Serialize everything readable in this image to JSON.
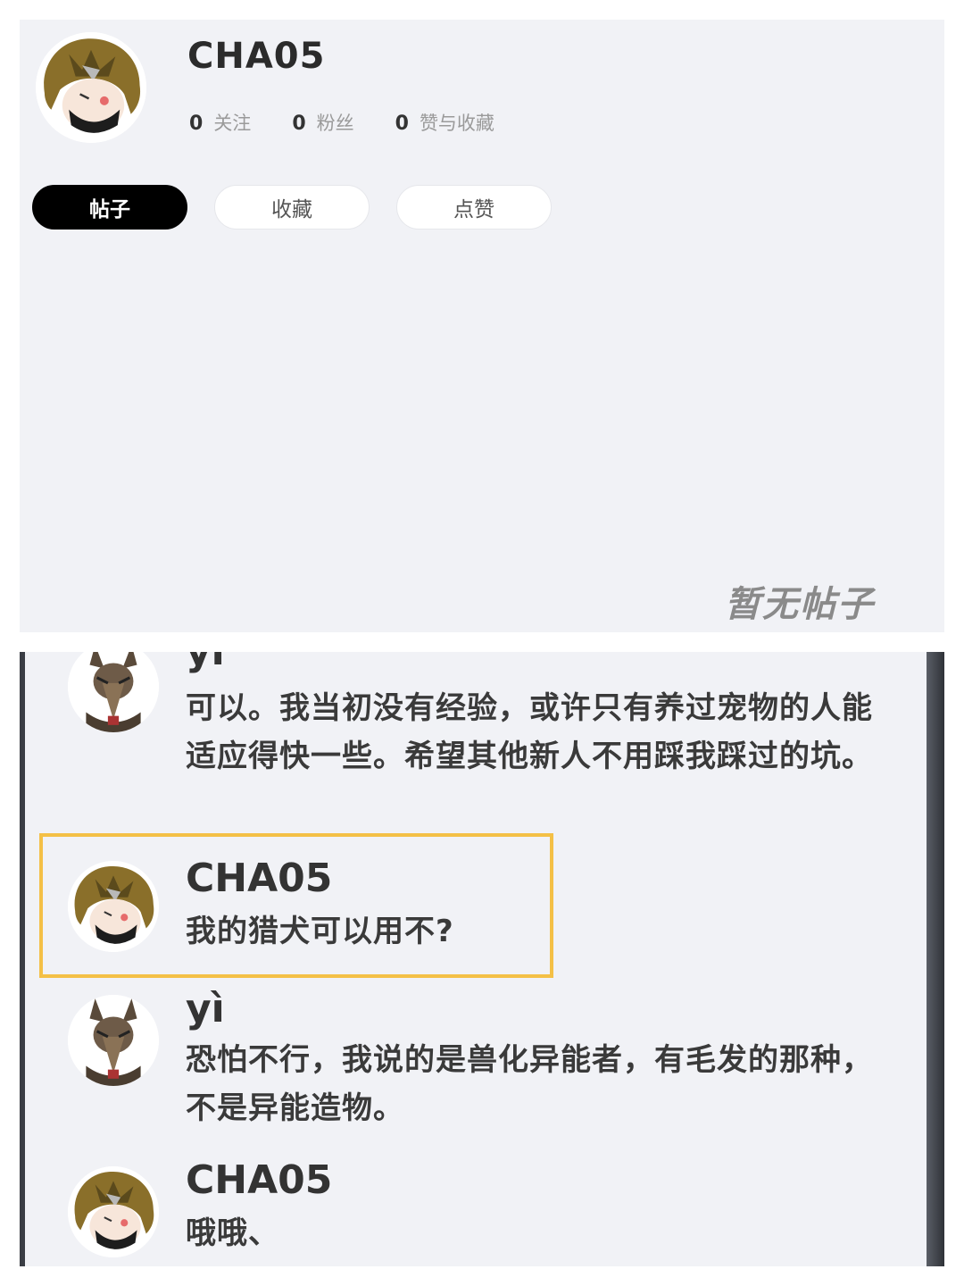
{
  "profile": {
    "username": "CHA05",
    "stats": [
      {
        "num": "0",
        "label": "关注"
      },
      {
        "num": "0",
        "label": "粉丝"
      },
      {
        "num": "0",
        "label": "赞与收藏"
      }
    ],
    "tabs": [
      {
        "label": "帖子",
        "active": true
      },
      {
        "label": "收藏",
        "active": false
      },
      {
        "label": "点赞",
        "active": false
      }
    ],
    "empty_text": "暂无帖子"
  },
  "chat": {
    "messages": [
      {
        "sender": "yì",
        "text": "可以。我当初没有经验，或许只有养过宠物的人能适应得快一些。希望其他新人不用踩我踩过的坑。"
      },
      {
        "sender": "CHA05",
        "text": "我的猎犬可以用不?",
        "highlighted": true
      },
      {
        "sender": "yì",
        "text": "恐怕不行，我说的是兽化异能者，有毛发的那种，不是异能造物。"
      },
      {
        "sender": "CHA05",
        "text": "哦哦、"
      }
    ]
  },
  "colors": {
    "highlight": "#f4c046",
    "active_tab": "#000000",
    "panel_bg": "#f1f2f6"
  }
}
